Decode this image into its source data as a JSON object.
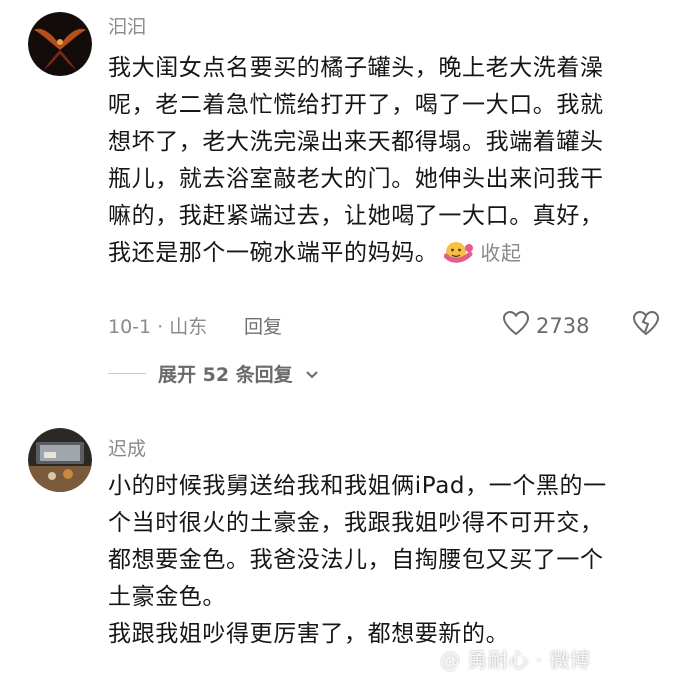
{
  "comments": [
    {
      "username": "汩汩",
      "lines": [
        "我大闺女点名要买的橘子罐头，晚上老大洗着澡",
        "呢，老二着急忙慌给打开了，喝了一大口。我就",
        "想坏了，老大洗完澡出来天都得塌。我端着罐头",
        "瓶儿，就去浴室敲老大的门。她伸头出来问我干",
        "嘛的，我赶紧端过去，让她喝了一大口。真好，",
        "我还是那个一碗水端平的妈妈。"
      ],
      "fold_label": "收起",
      "date_location": "10-1 · 山东",
      "reply_label": "回复",
      "like_count": "2738",
      "expand_label": "展开 52 条回复"
    },
    {
      "username": "迟成",
      "lines": [
        "小的时候我舅送给我和我姐俩iPad，一个黑的一",
        "个当时很火的土豪金，我跟我姐吵得不可开交，",
        "都想要金色。我爸没法儿，自掏腰包又买了一个",
        "土豪金色。",
        "我跟我姐吵得更厉害了，都想要新的。"
      ]
    }
  ],
  "watermark": "@ 勇耐心 · 微博"
}
